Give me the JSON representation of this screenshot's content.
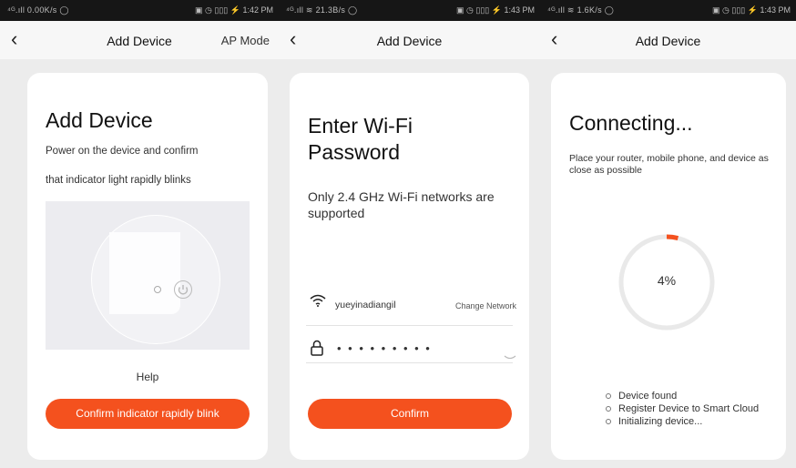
{
  "screens": [
    {
      "statusbar": {
        "left": "⁴ᴳ.ıll 0.00K/s ◯",
        "right": "▣ ◷ ▯▯▯ ⚡ 1:42 PM"
      },
      "nav": {
        "back": "‹",
        "title": "Add Device",
        "right": "AP Mode"
      },
      "card": {
        "title": "Add Device",
        "line1": "Power on the device and confirm",
        "line2": "that indicator light rapidly blinks",
        "help": "Help",
        "button": "Confirm indicator rapidly blink"
      }
    },
    {
      "statusbar": {
        "left": "⁴ᴳ.ıll ≋ 21.3B/s ◯",
        "right": "▣ ◷ ▯▯▯ ⚡ 1:43 PM"
      },
      "nav": {
        "back": "‹",
        "title": "Add Device"
      },
      "card": {
        "title_line1": "Enter Wi-Fi",
        "title_line2": "Password",
        "subtitle": "Only 2.4 GHz Wi-Fi networks are supported",
        "ssid": "yueyinadiangil",
        "change": "Change Network",
        "password": "• • • • • • • • •",
        "button": "Confirm"
      }
    },
    {
      "statusbar": {
        "left": "⁴ᴳ.ıll ≋ 1.6K/s ◯",
        "right": "▣ ◷ ▯▯▯ ⚡ 1:43 PM"
      },
      "nav": {
        "back": "‹",
        "title": "Add Device"
      },
      "card": {
        "title": "Connecting...",
        "desc": "Place your router, mobile phone, and device as close as possible",
        "percent_label": "4%",
        "steps": [
          "Device found",
          "Register Device to Smart Cloud",
          "Initializing device..."
        ]
      }
    }
  ],
  "progress": 0.04,
  "colors": {
    "accent": "#f4511e",
    "card": "#ffffff",
    "bg": "#ececec"
  },
  "icons": [
    "back-chevron-icon",
    "wifi-icon",
    "lock-icon",
    "eye-hidden-icon",
    "power-icon"
  ]
}
